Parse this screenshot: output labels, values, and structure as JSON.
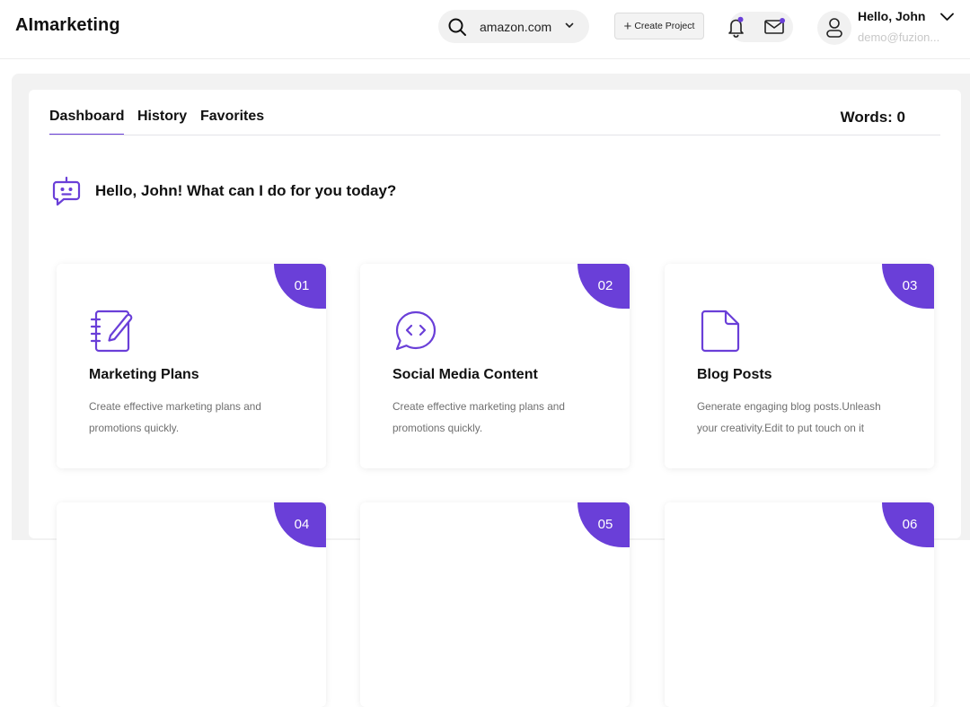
{
  "header": {
    "logo": "AImarketing",
    "site_select": {
      "value": "amazon.com"
    },
    "create_project_label": "Create Project",
    "user": {
      "greeting": "Hello, John",
      "email": "demo@fuzion..."
    }
  },
  "tabs": [
    {
      "label": "Dashboard",
      "active": true
    },
    {
      "label": "History",
      "active": false
    },
    {
      "label": "Favorites",
      "active": false
    }
  ],
  "words_label": "Words: 0",
  "greeting": "Hello, John! What can I do for you today?",
  "cards": [
    {
      "num": "01",
      "title": "Marketing Plans",
      "description": "Create effective marketing plans and promotions quickly.",
      "icon": "notebook-pen-icon"
    },
    {
      "num": "02",
      "title": "Social Media Content",
      "description": "Create effective marketing plans and promotions quickly.",
      "icon": "chat-code-icon"
    },
    {
      "num": "03",
      "title": "Blog Posts",
      "description": "Generate engaging blog posts.Unleash your creativity.Edit to put touch on it",
      "icon": "document-icon"
    },
    {
      "num": "04"
    },
    {
      "num": "05"
    },
    {
      "num": "06"
    }
  ],
  "colors": {
    "accent": "#6a3fd8",
    "page_bg": "#f2f2f2",
    "card_bg": "#ffffff",
    "muted_text": "#6f6f6f"
  }
}
